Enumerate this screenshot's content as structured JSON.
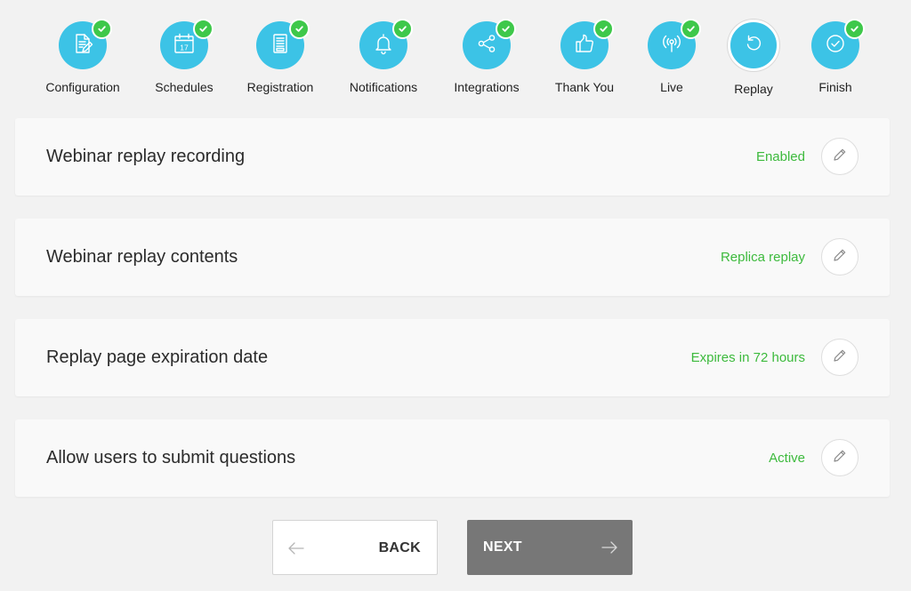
{
  "steps": [
    {
      "label": "Configuration",
      "icon": "document-edit-icon",
      "completed": true
    },
    {
      "label": "Schedules",
      "icon": "calendar-icon",
      "calendar_day": "17",
      "completed": true
    },
    {
      "label": "Registration",
      "icon": "form-icon",
      "completed": true
    },
    {
      "label": "Notifications",
      "icon": "bell-icon",
      "completed": true
    },
    {
      "label": "Integrations",
      "icon": "share-icon",
      "completed": true
    },
    {
      "label": "Thank You",
      "icon": "thumbs-up-icon",
      "completed": true
    },
    {
      "label": "Live",
      "icon": "broadcast-icon",
      "completed": true
    },
    {
      "label": "Replay",
      "icon": "replay-icon",
      "completed": false,
      "current": true
    },
    {
      "label": "Finish",
      "icon": "check-circle-icon",
      "completed": true
    }
  ],
  "settings": [
    {
      "title": "Webinar replay recording",
      "status": "Enabled"
    },
    {
      "title": "Webinar replay contents",
      "status": "Replica replay"
    },
    {
      "title": "Replay page expiration date",
      "status": "Expires in 72 hours"
    },
    {
      "title": "Allow users to submit questions",
      "status": "Active"
    }
  ],
  "buttons": {
    "back": "BACK",
    "next": "NEXT"
  },
  "colors": {
    "step_circle": "#3cc3e6",
    "check_badge": "#3ec84a",
    "status_text": "#3dba3d",
    "background": "#f2f2f2",
    "card": "#f9f9f9",
    "next_button": "#777777"
  }
}
